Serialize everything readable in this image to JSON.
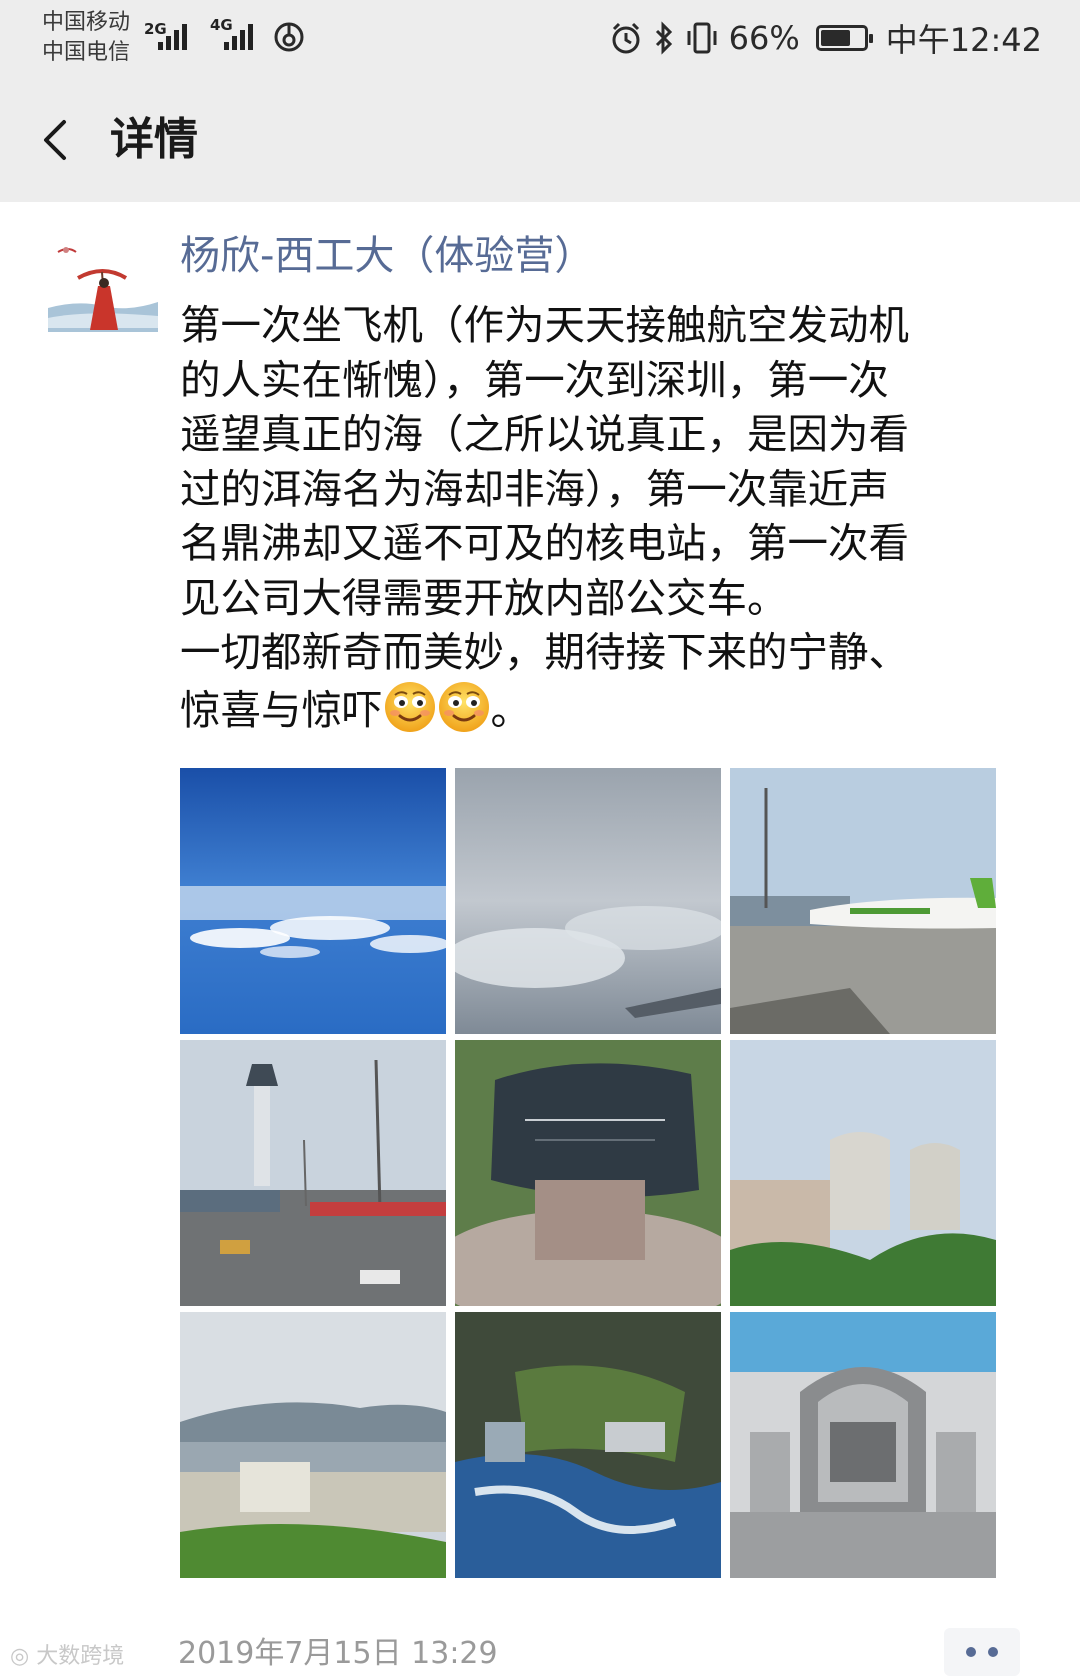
{
  "status_bar": {
    "carrier_1": "中国移动",
    "carrier_2": "中国电信",
    "network_1": "2G",
    "network_2": "4G",
    "battery_percent": "66%",
    "battery_level": 0.66,
    "time": "中午12:42"
  },
  "nav": {
    "title": "详情"
  },
  "post": {
    "author": "杨欣-西工大（体验营）",
    "text_lines": [
      "第一次坐飞机（作为天天接触航空发动机",
      "的人实在惭愧），第一次到深圳，第一次",
      "遥望真正的海（之所以说真正，是因为看",
      "过的洱海名为海却非海），第一次靠近声",
      "名鼎沸却又遥不可及的核电站，第一次看",
      "见公司大得需要开放内部公交车。",
      "一切都新奇而美妙，期待接下来的宁静、",
      "惊喜与惊吓"
    ],
    "text_end": "。",
    "emoji": "smiling-face-icon",
    "photos": [
      "sky-above-clouds",
      "clouds-from-airplane-window",
      "airplane-at-airport",
      "airport-control-tower",
      "engraved-stone-monument",
      "nuclear-power-plant",
      "coastal-power-station",
      "power-plant-site-model",
      "reactor-building-model"
    ],
    "timestamp": "2019年7月15日 13:29"
  },
  "watermark": "大数跨境",
  "colors": {
    "header_bg": "#ededed",
    "name_blue": "#576b95",
    "timestamp_gray": "#9a9a9a"
  }
}
